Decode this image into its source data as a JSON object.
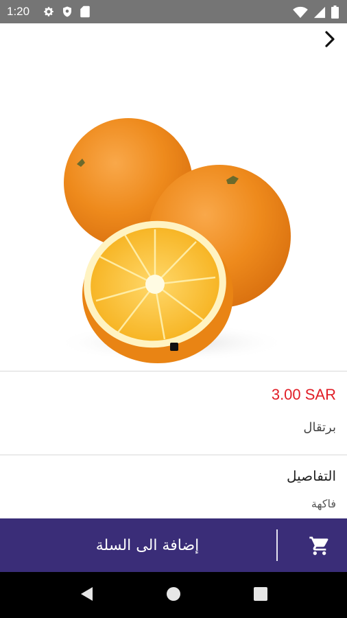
{
  "status_bar": {
    "time": "1:20",
    "left_icons": [
      "gear-icon",
      "shield-icon",
      "sd-card-icon"
    ],
    "right_icons": [
      "wifi-icon",
      "signal-icon",
      "battery-icon"
    ]
  },
  "header": {
    "back_icon": "chevron-right-icon"
  },
  "product": {
    "image_subject": "oranges",
    "price": "3.00 SAR",
    "name": "برتقال",
    "details_title": "التفاصيل",
    "details_value": "فاكهة"
  },
  "cart_bar": {
    "label": "إضافة الى السلة",
    "icon": "cart-icon"
  },
  "nav_bar": {
    "buttons": [
      "back-triangle-icon",
      "home-circle-icon",
      "recents-square-icon"
    ]
  },
  "colors": {
    "status_bar_bg": "#757575",
    "price_red": "#e11d26",
    "cart_bar_bg": "#3a2d78",
    "nav_bar_bg": "#000000"
  }
}
